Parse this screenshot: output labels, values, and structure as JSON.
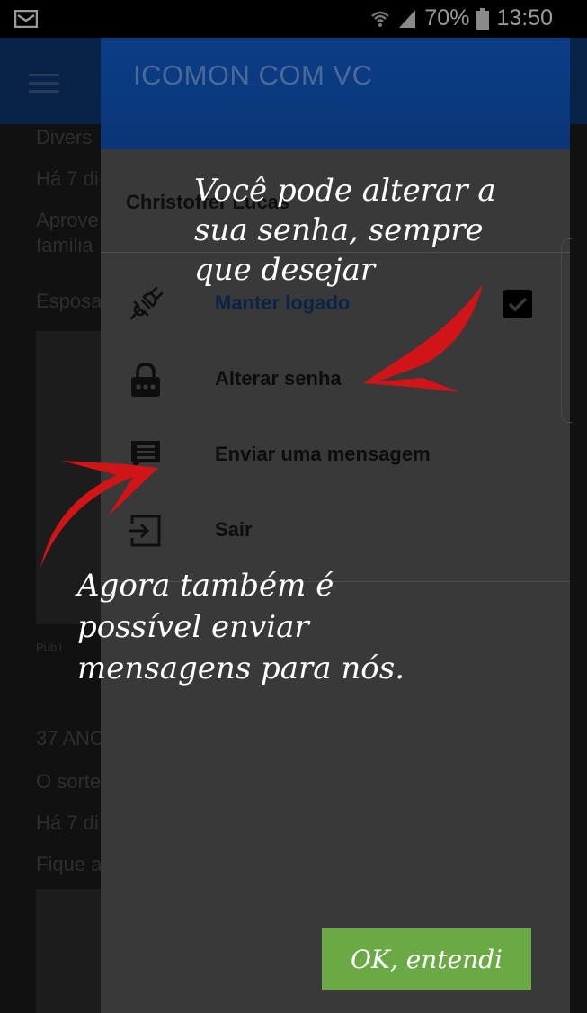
{
  "status_bar": {
    "battery": "70%",
    "time": "13:50",
    "icons": [
      "mail-icon",
      "wifi-icon",
      "signal-icon",
      "battery-icon"
    ]
  },
  "background_app": {
    "snippets": [
      "Divers",
      "Há 7 di",
      "Aprove",
      "familia",
      "Esposa",
      "Publi",
      "37 ANO",
      "O sorte",
      "Há 7 di",
      "Fique a"
    ]
  },
  "drawer": {
    "title": "ICOMON COM VC",
    "user_name": "Christoffer Lucas",
    "items": [
      {
        "label": "Manter logado",
        "icon": "plug-icon",
        "checked": true
      },
      {
        "label": "Alterar senha",
        "icon": "lock-icon"
      },
      {
        "label": "Enviar uma mensagem",
        "icon": "message-icon"
      },
      {
        "label": "Sair",
        "icon": "exit-icon"
      }
    ]
  },
  "tutorial": {
    "note_top": [
      "Você pode alterar a",
      "sua senha, sempre",
      "que desejar"
    ],
    "note_bottom": [
      "Agora também é",
      "possível enviar",
      "mensagens para nós."
    ],
    "ok_label": "OK, entendi",
    "arrow_color": "#d01418",
    "button_color": "#6ba945"
  }
}
